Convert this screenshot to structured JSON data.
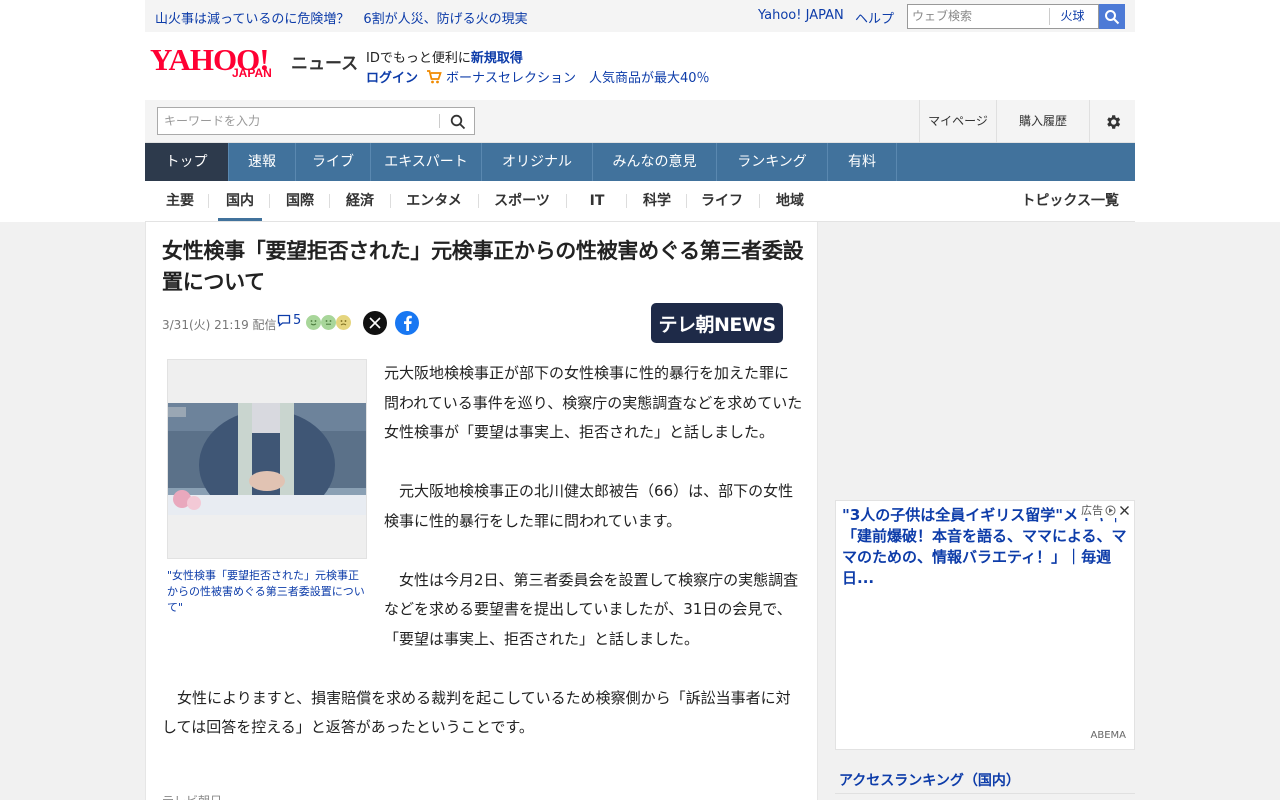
{
  "util": {
    "headlines": [
      "山火事は減っているのに危険増？",
      "6割が人災、防げる火の現実"
    ],
    "yahoo_japan": "Yahoo! JAPAN",
    "help": "ヘルプ",
    "web_search_placeholder": "ウェブ検索",
    "web_search_value": "火球"
  },
  "logo": {
    "yahoo": "YAHOO!",
    "japan": "JAPAN",
    "news": "ニュース"
  },
  "promo": {
    "line1_prefix": "IDでもっと便利に",
    "line1_link": "新規取得",
    "login": "ログイン",
    "line2": "ボーナスセレクション　人気商品が最大40％"
  },
  "search": {
    "placeholder": "キーワードを入力",
    "mypage": "マイページ",
    "purchase_history": "購入履歴"
  },
  "mainnav": [
    {
      "label": "トップ",
      "active": true
    },
    {
      "label": "速報"
    },
    {
      "label": "ライブ"
    },
    {
      "label": "エキスパート"
    },
    {
      "label": "オリジナル"
    },
    {
      "label": "みんなの意見"
    },
    {
      "label": "ランキング"
    },
    {
      "label": "有料"
    }
  ],
  "subnav": [
    {
      "label": "主要"
    },
    {
      "label": "国内",
      "active": true
    },
    {
      "label": "国際"
    },
    {
      "label": "経済"
    },
    {
      "label": "エンタメ"
    },
    {
      "label": "スポーツ"
    },
    {
      "label": "IT"
    },
    {
      "label": "科学"
    },
    {
      "label": "ライフ"
    },
    {
      "label": "地域"
    }
  ],
  "topics_all": "トピックス一覧",
  "article": {
    "title": "女性検事「要望拒否された」元検事正からの性被害めぐる第三者委設置について",
    "date": "3/31(火) 21:19",
    "date_suffix": "配信",
    "comment_count": "5",
    "publisher": "テレ朝NEWS",
    "image_caption": "\"女性検事「要望拒否された」元検事正からの性被害めぐる第三者委設置について\"",
    "paragraphs": [
      "元大阪地検検事正が部下の女性検事に性的暴行を加えた罪に問われている事件を巡り、検察庁の実態調査などを求めていた女性検事が「要望は事実上、拒否された」と話しました。",
      "　元大阪地検検事正の北川健太郎被告（66）は、部下の女性検事に性的暴行をした罪に問われています。",
      "　女性は今月2日、第三者委員会を設置して検察庁の実態調査などを求める要望書を提出していましたが、31日の会見で、「要望は事実上、拒否された」と話しました。",
      "　女性によりますと、損害賠償を求める裁判を起こしているため検察側から「訴訟当事者に対しては回答を控える」と返答があったということです。"
    ],
    "credit": "テレビ朝日"
  },
  "ad": {
    "title": "\"3人の子供は全員イギリス留学\"メイキ｜「建前爆破！本音を語る、ママによる、ママのための、情報バラエティ！」｜毎週日...",
    "label": "広告",
    "source": "ABEMA"
  },
  "ranking": {
    "title": "アクセスランキング（国内）"
  },
  "colors": {
    "nav_bg": "#41729c",
    "nav_active": "#2d3a4c",
    "link": "#0d3ca9",
    "brand_red": "#ff0033"
  }
}
